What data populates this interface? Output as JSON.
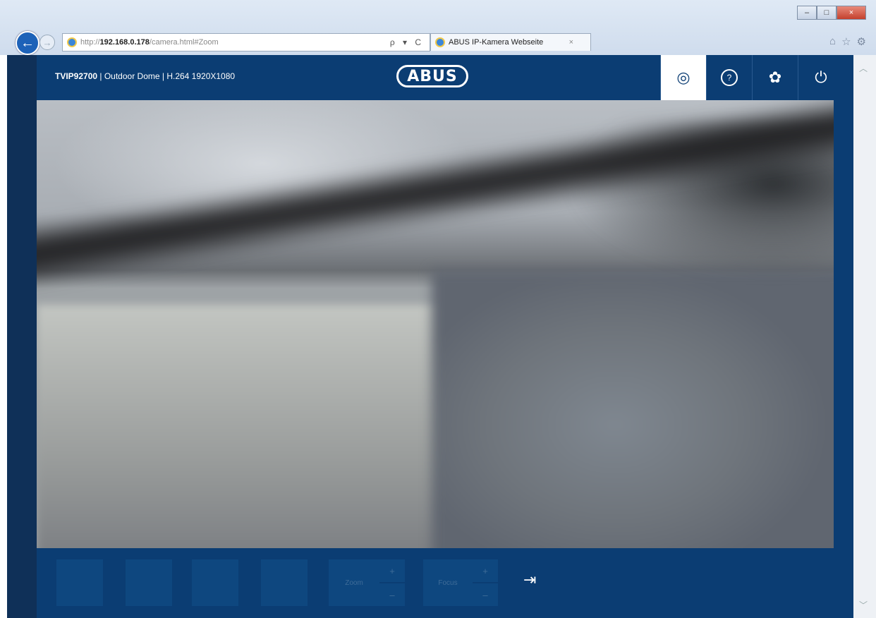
{
  "browser": {
    "url_prefix": "http://",
    "url_host": "192.168.0.178",
    "url_path": "/camera.html#Zoom",
    "address_tools": "ρ ▾ C",
    "tab_title": "ABUS IP-Kamera Webseite",
    "tab_close": "×",
    "back_glyph": "←",
    "forward_glyph": "→",
    "window_minimize": "–",
    "window_maximize": "□",
    "window_close": "×",
    "home_icon": "⌂",
    "favorites_icon": "☆",
    "tools_icon": "⚙"
  },
  "header": {
    "model": "TVIP92700",
    "info": " | Outdoor Dome | H.264 1920X1080",
    "logo": "ABUS"
  },
  "toolbar": {
    "live_icon": "◎",
    "help_icon": "?",
    "settings_icon": "✿",
    "power_icon": "⏻"
  },
  "controls": {
    "zoom_label": "Zoom",
    "focus_label": "Focus",
    "plus": "+",
    "minus": "–",
    "exit_icon": "⇥"
  }
}
